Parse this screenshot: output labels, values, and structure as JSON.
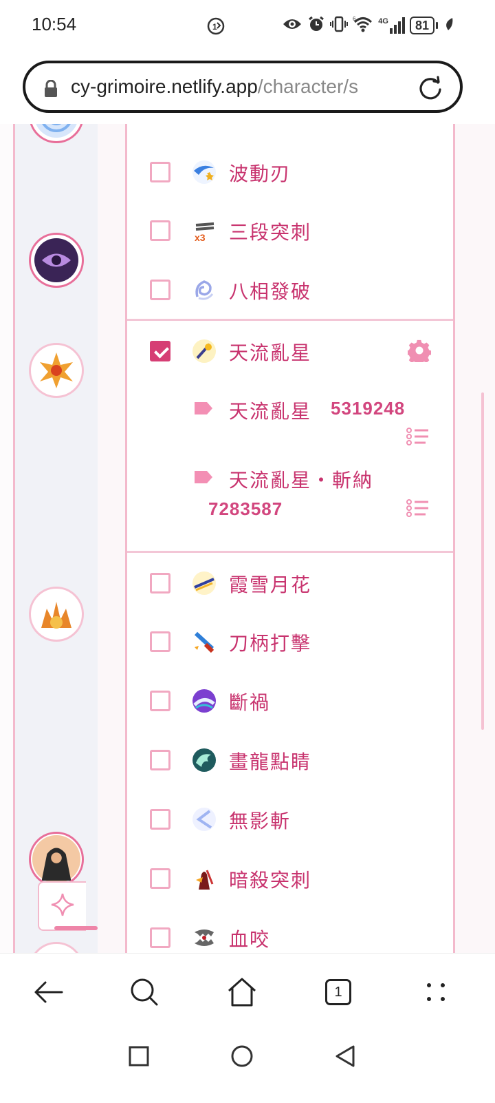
{
  "status_bar": {
    "time": "10:54",
    "network": "4G",
    "battery": "81",
    "icons": [
      "call-sim-icon",
      "eye-icon",
      "alarm-icon",
      "vibrate-icon",
      "wifi-icon",
      "signal-icon",
      "battery-icon",
      "leaf-icon"
    ]
  },
  "browser": {
    "url_host": "cy-grimoire.netlify.app",
    "url_path": "/character/s",
    "tab_count": "1"
  },
  "skills_top": [
    {
      "label": "波動刃",
      "checked": false,
      "icon": "wave-blade-icon"
    },
    {
      "label": "三段突刺",
      "checked": false,
      "icon": "triple-thrust-icon"
    },
    {
      "label": "八相發破",
      "checked": false,
      "icon": "eight-phase-icon"
    }
  ],
  "selected_skill": {
    "label": "天流亂星",
    "checked": true,
    "icon": "meteor-icon",
    "effects": [
      {
        "name": "天流亂星",
        "id": "5319248"
      },
      {
        "name": "天流亂星・斬納",
        "id": "7283587"
      }
    ]
  },
  "skills_bottom": [
    {
      "label": "霞雪月花",
      "checked": false,
      "icon": "moon-flower-icon"
    },
    {
      "label": "刀柄打擊",
      "checked": false,
      "icon": "hilt-strike-icon"
    },
    {
      "label": "斷禍",
      "checked": false,
      "icon": "sever-icon"
    },
    {
      "label": "畫龍點睛",
      "checked": false,
      "icon": "dragon-icon"
    },
    {
      "label": "無影斬",
      "checked": false,
      "icon": "shadowless-icon"
    },
    {
      "label": "暗殺突刺",
      "checked": false,
      "icon": "assassin-icon"
    },
    {
      "label": "血咬",
      "checked": false,
      "icon": "blood-bite-icon"
    }
  ],
  "colors": {
    "accent": "#d63e74",
    "text_pink": "#c8336e",
    "border_pink": "#f3b9cc"
  }
}
